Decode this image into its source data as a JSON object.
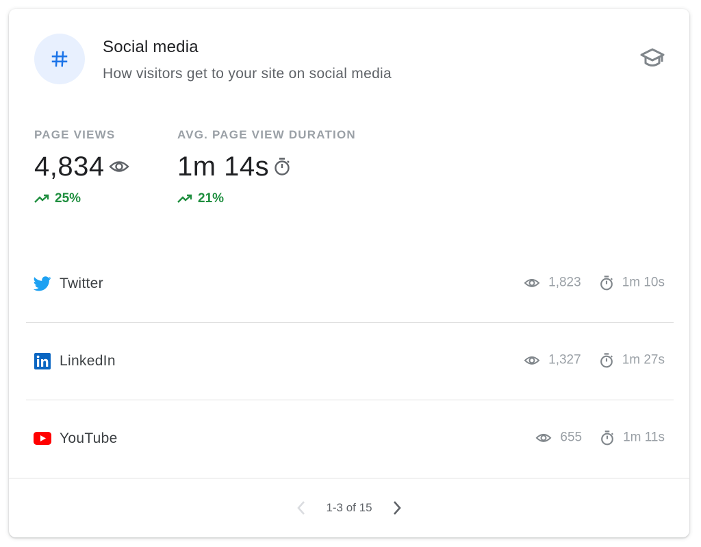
{
  "card": {
    "title": "Social media",
    "subtitle": "How visitors get to your site on social media",
    "header_icon": "hashtag-icon",
    "learn_icon": "school-icon"
  },
  "metrics": [
    {
      "label": "PAGE VIEWS",
      "value": "4,834",
      "icon": "eye-icon",
      "change": "25%",
      "trend": "up"
    },
    {
      "label": "AVG. PAGE VIEW DURATION",
      "value": "1m 14s",
      "icon": "timer-icon",
      "change": "21%",
      "trend": "up"
    }
  ],
  "sources": [
    {
      "name": "Twitter",
      "icon": "twitter-icon",
      "views": "1,823",
      "duration": "1m 10s"
    },
    {
      "name": "LinkedIn",
      "icon": "linkedin-icon",
      "views": "1,327",
      "duration": "1m 27s"
    },
    {
      "name": "YouTube",
      "icon": "youtube-icon",
      "views": "655",
      "duration": "1m 11s"
    }
  ],
  "pagination": {
    "text": "1-3 of 15",
    "prev_icon": "chevron-left-icon",
    "next_icon": "chevron-right-icon",
    "prev_enabled": false,
    "next_enabled": true
  },
  "colors": {
    "accent_blue": "#1a73e8",
    "icon_circle_bg": "#e8f0fe",
    "positive_green": "#1e8e3e",
    "twitter_blue": "#1da1f2",
    "linkedin_blue": "#0a66c2",
    "youtube_red": "#ff0000",
    "muted_gray": "#9aa0a6"
  }
}
